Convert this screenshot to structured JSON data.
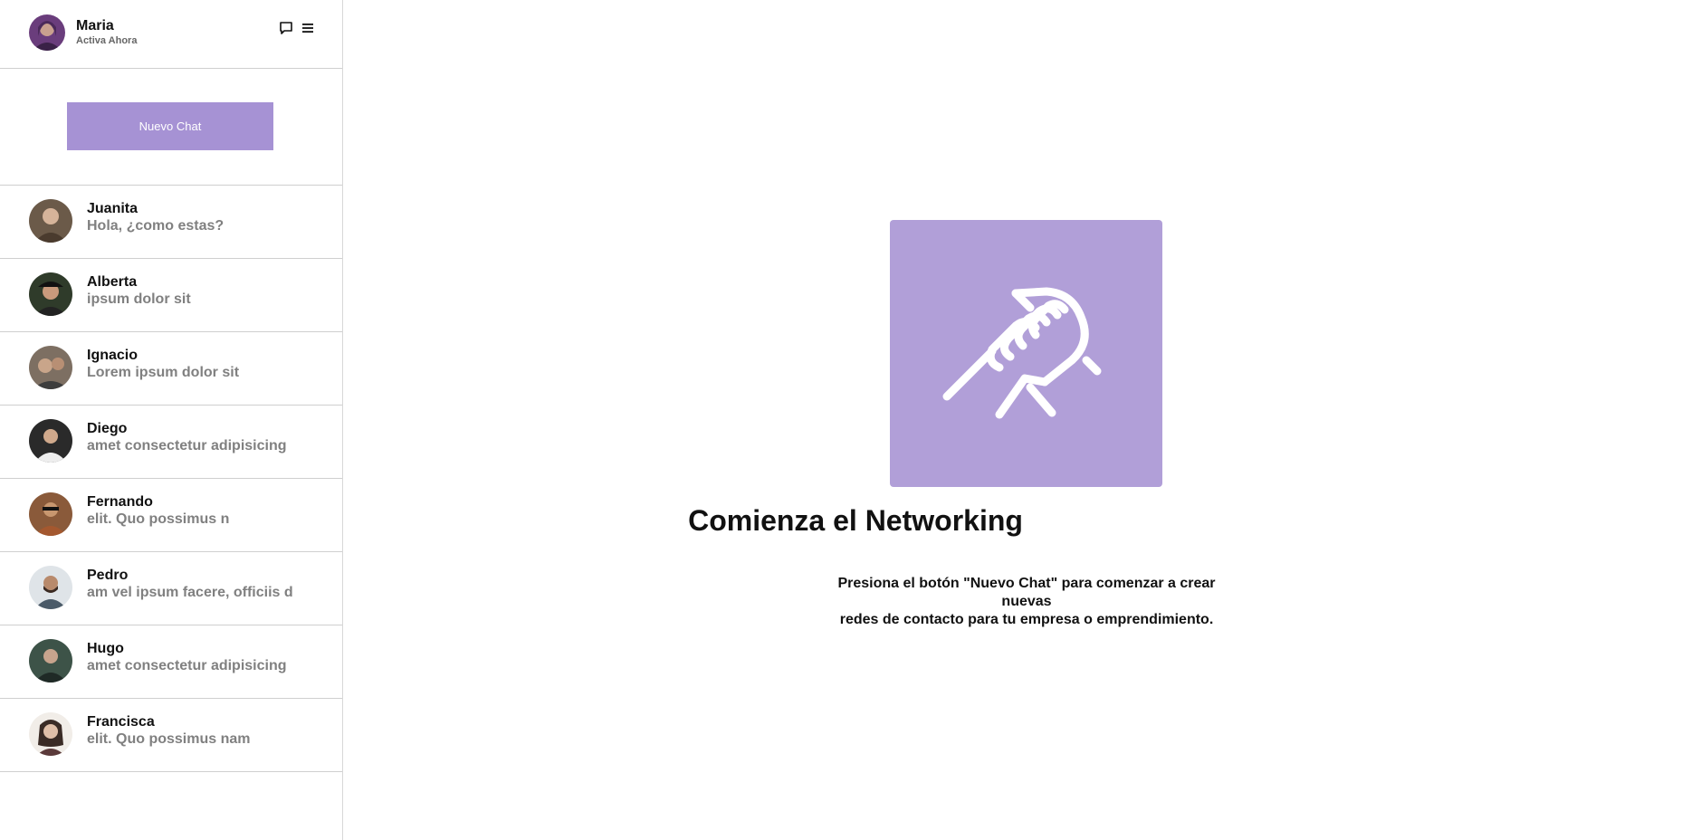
{
  "user": {
    "name": "Maria",
    "status": "Activa Ahora",
    "avatar_color": "#6a3d7c"
  },
  "header_icons": [
    "chat-bubble-icon",
    "menu-icon"
  ],
  "new_chat": {
    "label": "Nuevo Chat",
    "color": "#a692d4"
  },
  "contacts": [
    {
      "name": "Juanita",
      "message": "Hola, ¿como estas?",
      "avatar_color": "#6b5a49"
    },
    {
      "name": "Alberta",
      "message": "ipsum dolor sit",
      "avatar_color": "#2f3b2a"
    },
    {
      "name": "Ignacio",
      "message": "Lorem ipsum dolor sit",
      "avatar_color": "#7d6f62"
    },
    {
      "name": "Diego",
      "message": "amet consectetur adipisicing",
      "avatar_color": "#2a2a2a"
    },
    {
      "name": "Fernando",
      "message": "elit. Quo possimus n",
      "avatar_color": "#8a5a3a"
    },
    {
      "name": "Pedro",
      "message": "am vel ipsum facere, officiis d",
      "avatar_color": "#4a5a68"
    },
    {
      "name": "Hugo",
      "message": "amet consectetur adipisicing",
      "avatar_color": "#3d5348"
    },
    {
      "name": "Francisca",
      "message": "elit. Quo possimus nam",
      "avatar_color": "#3a2b25"
    }
  ],
  "main": {
    "icon": "handshake-icon",
    "box_color": "#b19fd8",
    "title": "Comienza el Networking",
    "text_line1": "Presiona el botón \"Nuevo Chat\" para comenzar a crear nuevas",
    "text_line2": "redes de contacto para tu empresa o emprendimiento."
  }
}
